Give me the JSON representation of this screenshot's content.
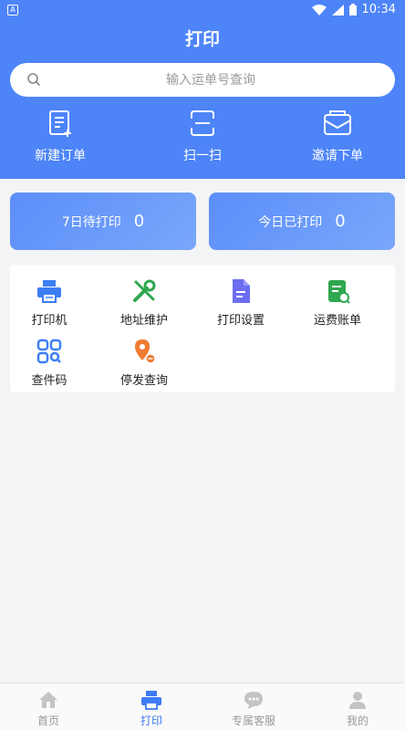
{
  "statusbar": {
    "left_badge": "A",
    "time": "10:34"
  },
  "header": {
    "title": "打印"
  },
  "search": {
    "placeholder": "输入运单号查询"
  },
  "quick_actions": [
    {
      "label": "新建订单",
      "icon": "new-order-icon"
    },
    {
      "label": "扫一扫",
      "icon": "scan-icon"
    },
    {
      "label": "邀请下单",
      "icon": "invite-mail-icon"
    }
  ],
  "stats": [
    {
      "label": "7日待打印",
      "value": "0"
    },
    {
      "label": "今日已打印",
      "value": "0"
    }
  ],
  "tools": [
    {
      "label": "打印机",
      "icon": "printer-icon"
    },
    {
      "label": "地址维护",
      "icon": "wrench-icon"
    },
    {
      "label": "打印设置",
      "icon": "document-icon"
    },
    {
      "label": "运费账单",
      "icon": "bill-icon"
    },
    {
      "label": "查件码",
      "icon": "qr-code-icon"
    },
    {
      "label": "停发查询",
      "icon": "location-pin-icon"
    }
  ],
  "nav": {
    "items": [
      {
        "label": "首页",
        "icon": "home-icon",
        "active": false
      },
      {
        "label": "打印",
        "icon": "printer-icon",
        "active": true
      },
      {
        "label": "专属客服",
        "icon": "chat-icon",
        "active": false
      },
      {
        "label": "我的",
        "icon": "user-icon",
        "active": false
      }
    ]
  },
  "colors": {
    "primary": "#4d84f8",
    "nav_active": "#3f7af5",
    "tool_blue": "#3d7ef6",
    "tool_green": "#2fa84f",
    "tool_purple": "#6b6ef0",
    "tool_orange": "#f07b31",
    "background": "#f3f4f6"
  }
}
